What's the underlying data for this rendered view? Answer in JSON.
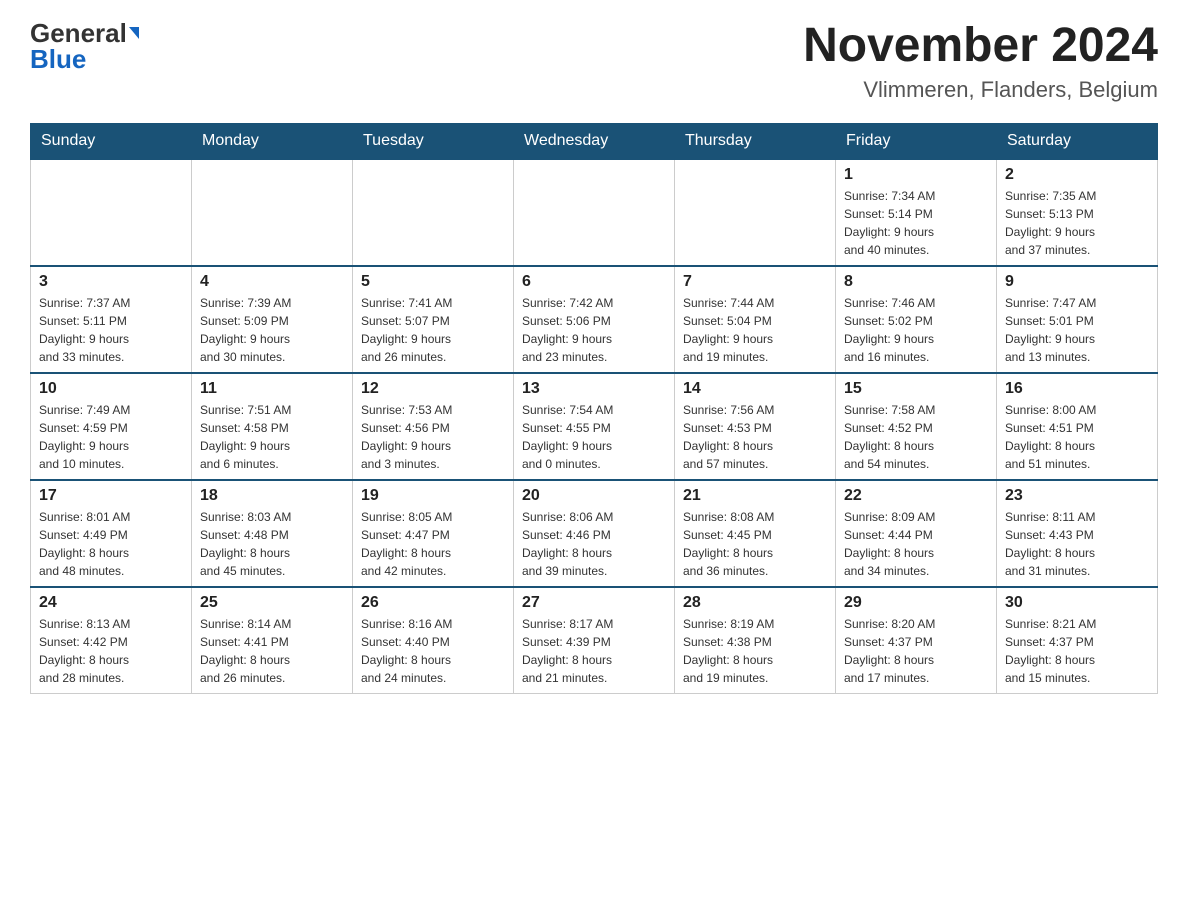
{
  "header": {
    "logo_general": "General",
    "logo_blue": "Blue",
    "month_year": "November 2024",
    "location": "Vlimmeren, Flanders, Belgium"
  },
  "days_of_week": [
    "Sunday",
    "Monday",
    "Tuesday",
    "Wednesday",
    "Thursday",
    "Friday",
    "Saturday"
  ],
  "weeks": [
    {
      "days": [
        {
          "num": "",
          "info": ""
        },
        {
          "num": "",
          "info": ""
        },
        {
          "num": "",
          "info": ""
        },
        {
          "num": "",
          "info": ""
        },
        {
          "num": "",
          "info": ""
        },
        {
          "num": "1",
          "info": "Sunrise: 7:34 AM\nSunset: 5:14 PM\nDaylight: 9 hours\nand 40 minutes."
        },
        {
          "num": "2",
          "info": "Sunrise: 7:35 AM\nSunset: 5:13 PM\nDaylight: 9 hours\nand 37 minutes."
        }
      ]
    },
    {
      "days": [
        {
          "num": "3",
          "info": "Sunrise: 7:37 AM\nSunset: 5:11 PM\nDaylight: 9 hours\nand 33 minutes."
        },
        {
          "num": "4",
          "info": "Sunrise: 7:39 AM\nSunset: 5:09 PM\nDaylight: 9 hours\nand 30 minutes."
        },
        {
          "num": "5",
          "info": "Sunrise: 7:41 AM\nSunset: 5:07 PM\nDaylight: 9 hours\nand 26 minutes."
        },
        {
          "num": "6",
          "info": "Sunrise: 7:42 AM\nSunset: 5:06 PM\nDaylight: 9 hours\nand 23 minutes."
        },
        {
          "num": "7",
          "info": "Sunrise: 7:44 AM\nSunset: 5:04 PM\nDaylight: 9 hours\nand 19 minutes."
        },
        {
          "num": "8",
          "info": "Sunrise: 7:46 AM\nSunset: 5:02 PM\nDaylight: 9 hours\nand 16 minutes."
        },
        {
          "num": "9",
          "info": "Sunrise: 7:47 AM\nSunset: 5:01 PM\nDaylight: 9 hours\nand 13 minutes."
        }
      ]
    },
    {
      "days": [
        {
          "num": "10",
          "info": "Sunrise: 7:49 AM\nSunset: 4:59 PM\nDaylight: 9 hours\nand 10 minutes."
        },
        {
          "num": "11",
          "info": "Sunrise: 7:51 AM\nSunset: 4:58 PM\nDaylight: 9 hours\nand 6 minutes."
        },
        {
          "num": "12",
          "info": "Sunrise: 7:53 AM\nSunset: 4:56 PM\nDaylight: 9 hours\nand 3 minutes."
        },
        {
          "num": "13",
          "info": "Sunrise: 7:54 AM\nSunset: 4:55 PM\nDaylight: 9 hours\nand 0 minutes."
        },
        {
          "num": "14",
          "info": "Sunrise: 7:56 AM\nSunset: 4:53 PM\nDaylight: 8 hours\nand 57 minutes."
        },
        {
          "num": "15",
          "info": "Sunrise: 7:58 AM\nSunset: 4:52 PM\nDaylight: 8 hours\nand 54 minutes."
        },
        {
          "num": "16",
          "info": "Sunrise: 8:00 AM\nSunset: 4:51 PM\nDaylight: 8 hours\nand 51 minutes."
        }
      ]
    },
    {
      "days": [
        {
          "num": "17",
          "info": "Sunrise: 8:01 AM\nSunset: 4:49 PM\nDaylight: 8 hours\nand 48 minutes."
        },
        {
          "num": "18",
          "info": "Sunrise: 8:03 AM\nSunset: 4:48 PM\nDaylight: 8 hours\nand 45 minutes."
        },
        {
          "num": "19",
          "info": "Sunrise: 8:05 AM\nSunset: 4:47 PM\nDaylight: 8 hours\nand 42 minutes."
        },
        {
          "num": "20",
          "info": "Sunrise: 8:06 AM\nSunset: 4:46 PM\nDaylight: 8 hours\nand 39 minutes."
        },
        {
          "num": "21",
          "info": "Sunrise: 8:08 AM\nSunset: 4:45 PM\nDaylight: 8 hours\nand 36 minutes."
        },
        {
          "num": "22",
          "info": "Sunrise: 8:09 AM\nSunset: 4:44 PM\nDaylight: 8 hours\nand 34 minutes."
        },
        {
          "num": "23",
          "info": "Sunrise: 8:11 AM\nSunset: 4:43 PM\nDaylight: 8 hours\nand 31 minutes."
        }
      ]
    },
    {
      "days": [
        {
          "num": "24",
          "info": "Sunrise: 8:13 AM\nSunset: 4:42 PM\nDaylight: 8 hours\nand 28 minutes."
        },
        {
          "num": "25",
          "info": "Sunrise: 8:14 AM\nSunset: 4:41 PM\nDaylight: 8 hours\nand 26 minutes."
        },
        {
          "num": "26",
          "info": "Sunrise: 8:16 AM\nSunset: 4:40 PM\nDaylight: 8 hours\nand 24 minutes."
        },
        {
          "num": "27",
          "info": "Sunrise: 8:17 AM\nSunset: 4:39 PM\nDaylight: 8 hours\nand 21 minutes."
        },
        {
          "num": "28",
          "info": "Sunrise: 8:19 AM\nSunset: 4:38 PM\nDaylight: 8 hours\nand 19 minutes."
        },
        {
          "num": "29",
          "info": "Sunrise: 8:20 AM\nSunset: 4:37 PM\nDaylight: 8 hours\nand 17 minutes."
        },
        {
          "num": "30",
          "info": "Sunrise: 8:21 AM\nSunset: 4:37 PM\nDaylight: 8 hours\nand 15 minutes."
        }
      ]
    }
  ]
}
